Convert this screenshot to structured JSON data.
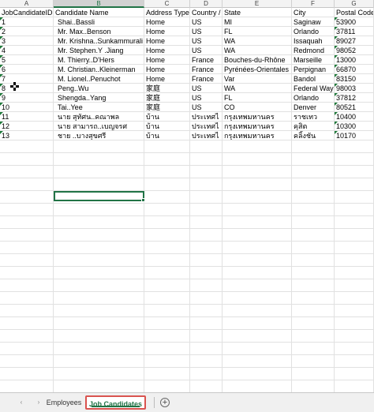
{
  "columns": [
    "A",
    "B",
    "C",
    "D",
    "E",
    "F",
    "G"
  ],
  "active_column": "B",
  "headers": [
    "JobCandidateID",
    "Candidate Name",
    "Address Type",
    "Country /",
    "State",
    "City",
    "Postal Code"
  ],
  "rows": [
    [
      "1",
      "Shai..Bassli",
      "Home",
      "US",
      "MI",
      "Saginaw",
      "53900"
    ],
    [
      "2",
      "Mr. Max..Benson",
      "Home",
      "US",
      "FL",
      "Orlando",
      "37811"
    ],
    [
      "3",
      "Mr. Krishna..Sunkammurali",
      "Home",
      "US",
      "WA",
      "Issaquah",
      "89027"
    ],
    [
      "4",
      "Mr. Stephen.Y .Jiang",
      "Home",
      "US",
      "WA",
      "Redmond",
      "98052"
    ],
    [
      "5",
      "M. Thierry..D'Hers",
      "Home",
      "France",
      "Bouches-du-Rhône",
      "Marseille",
      "13000"
    ],
    [
      "6",
      "M. Christian..Kleinerman",
      "Home",
      "France",
      "Pyrénées-Orientales",
      "Perpignan",
      "66870"
    ],
    [
      "7",
      "M. Lionel..Penuchot",
      "Home",
      "France",
      "Var",
      "Bandol",
      "83150"
    ],
    [
      "8",
      "Peng..Wu",
      "家庭",
      "US",
      "WA",
      "Federal Way",
      "98003"
    ],
    [
      "9",
      "Shengda..Yang",
      "家庭",
      "US",
      "FL",
      "Orlando",
      "37812"
    ],
    [
      "10",
      "Tai..Yee",
      "家庭",
      "US",
      "CO",
      "Denver",
      "80521"
    ],
    [
      "11",
      "นาย สุทัศน..คณาพล",
      "บ้าน",
      "ประเทศไ",
      "กรุงเทพมหานคร",
      "ราชเทว",
      "10400"
    ],
    [
      "12",
      "นาย สามารถ..เบญจรศ",
      "บ้าน",
      "ประเทศไ",
      "กรุงเทพมหานคร",
      "คุสิต",
      "10300"
    ],
    [
      "13",
      "ชาย ..บางสุขศรี",
      "บ้าน",
      "ประเทศไ",
      "กรุงเทพมหานคร",
      "คลิ้งชัน",
      "10170"
    ]
  ],
  "sheet_tabs": {
    "nav_prev": "‹",
    "nav_next": "›",
    "tabs": [
      "Employees",
      "Job Candidates"
    ],
    "active": "Job Candidates",
    "add_label": "+"
  },
  "icons": {
    "add_sheet": "plus-circle-icon",
    "cursor": "cross-cursor-icon",
    "indicator": "green-triangle-indicator"
  },
  "colors": {
    "accent": "#217346",
    "highlight": "#d9534f"
  }
}
